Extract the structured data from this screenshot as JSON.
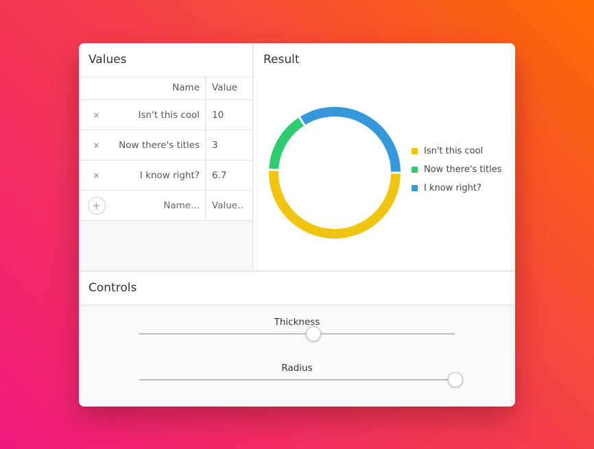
{
  "values": {
    "title": "Values",
    "columns": {
      "name": "Name",
      "value": "Value"
    },
    "rows": [
      {
        "remove": "×",
        "name": "Isn't this cool",
        "value": "10"
      },
      {
        "remove": "×",
        "name": "Now there's titles",
        "value": "3"
      },
      {
        "remove": "×",
        "name": "I know right?",
        "value": "6.7"
      }
    ],
    "new_row": {
      "add": "+",
      "name_placeholder": "Name...",
      "value_placeholder": "Value.."
    }
  },
  "result": {
    "title": "Result",
    "legend": [
      {
        "label": "Isn't this cool",
        "color": "#f1c40f"
      },
      {
        "label": "Now there's titles",
        "color": "#2ecc71"
      },
      {
        "label": "I know right?",
        "color": "#3498db"
      }
    ]
  },
  "chart_data": {
    "type": "pie",
    "categories": [
      "Isn't this cool",
      "Now there's titles",
      "I know right?"
    ],
    "values": [
      10,
      3,
      6.7
    ],
    "colors": [
      "#f1c40f",
      "#2ecc71",
      "#3498db"
    ]
  },
  "controls": {
    "title": "Controls",
    "thickness": {
      "label": "Thickness",
      "level": 0.55
    },
    "radius": {
      "label": "Radius",
      "level": 1.0
    }
  }
}
